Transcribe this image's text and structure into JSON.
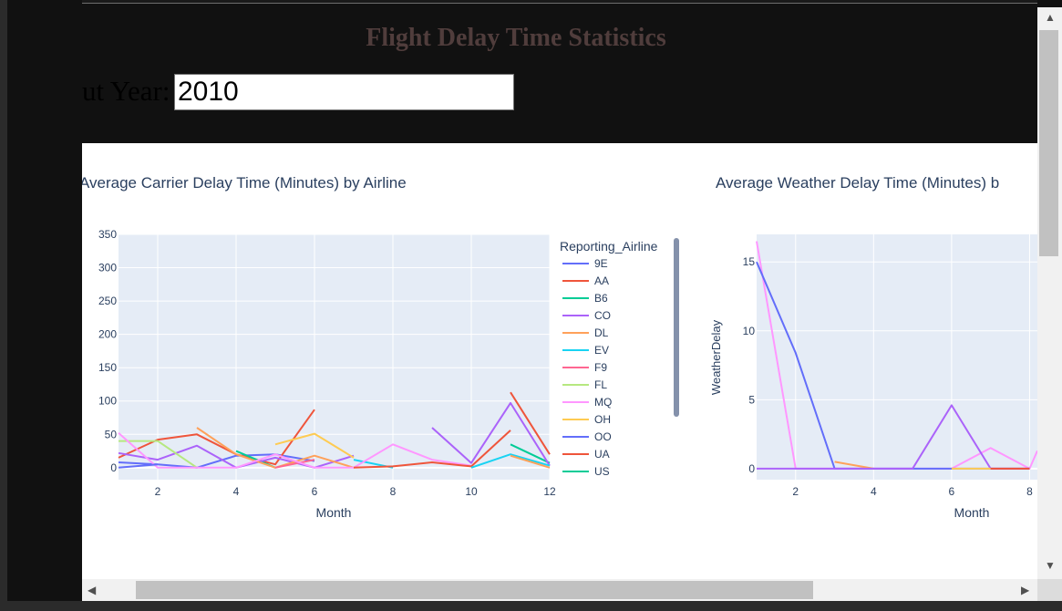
{
  "header": {
    "title": "Flight Delay Time Statistics",
    "year_label": "ut Year:",
    "year_value": "2010"
  },
  "colors": {
    "title": "#503d3c",
    "plot_bg": "#e5ecf6",
    "text": "#2a3f5f"
  },
  "legend": {
    "title": "Reporting_Airline",
    "items": [
      "9E",
      "AA",
      "B6",
      "CO",
      "DL",
      "EV",
      "F9",
      "FL",
      "MQ",
      "OH",
      "OO",
      "UA",
      "US"
    ]
  },
  "chart_data": [
    {
      "type": "line",
      "title": "Average Carrier Delay Time (Minutes) by Airline",
      "xlabel": "Month",
      "ylabel": "",
      "xlim": [
        1,
        12
      ],
      "ylim": [
        -18,
        350
      ],
      "x_ticks": [
        2,
        4,
        6,
        8,
        10,
        12
      ],
      "y_ticks": [
        0,
        50,
        100,
        150,
        200,
        250,
        300,
        350
      ],
      "series": [
        {
          "name": "9E",
          "color": "#636efa",
          "points": [
            [
              1,
              8
            ],
            [
              2,
              5
            ],
            [
              3,
              0
            ],
            [
              4,
              18
            ],
            [
              5,
              20
            ],
            [
              6,
              10
            ]
          ]
        },
        {
          "name": "AA",
          "color": "#ef553b",
          "points": [
            [
              1,
              15
            ],
            [
              2,
              42
            ],
            [
              3,
              50
            ],
            [
              4,
              20
            ],
            [
              5,
              5
            ],
            [
              6,
              87
            ]
          ]
        },
        {
          "name": "B6",
          "color": "#00cc96",
          "points": [
            [
              4,
              25
            ],
            [
              5,
              0
            ]
          ]
        },
        {
          "name": "CO",
          "color": "#ab63fa",
          "points": [
            [
              1,
              22
            ],
            [
              2,
              12
            ],
            [
              3,
              33
            ],
            [
              4,
              0
            ],
            [
              5,
              15
            ],
            [
              6,
              0
            ],
            [
              7,
              18
            ]
          ]
        },
        {
          "name": "DL",
          "color": "#ffa15a",
          "points": [
            [
              3,
              60
            ],
            [
              4,
              20
            ],
            [
              5,
              0
            ],
            [
              6,
              18
            ],
            [
              7,
              0
            ]
          ]
        },
        {
          "name": "EV",
          "color": "#19d3f3",
          "points": [
            [
              7,
              12
            ],
            [
              8,
              0
            ]
          ]
        },
        {
          "name": "F9",
          "color": "#ff6692",
          "points": [
            [
              5,
              0
            ],
            [
              6,
              12
            ]
          ]
        },
        {
          "name": "FL",
          "color": "#b6e880",
          "points": [
            [
              1,
              40
            ],
            [
              2,
              40
            ],
            [
              3,
              0
            ]
          ]
        },
        {
          "name": "MQ",
          "color": "#ff97ff",
          "points": [
            [
              1,
              52
            ],
            [
              2,
              0
            ],
            [
              3,
              0
            ],
            [
              4,
              0
            ],
            [
              5,
              20
            ],
            [
              6,
              0
            ],
            [
              7,
              0
            ],
            [
              8,
              35
            ],
            [
              9,
              12
            ],
            [
              10,
              3
            ]
          ]
        },
        {
          "name": "OH",
          "color": "#fecb52",
          "points": [
            [
              5,
              35
            ],
            [
              6,
              51
            ],
            [
              7,
              15
            ]
          ]
        },
        {
          "name": "OO",
          "color": "#636efa",
          "points": [
            [
              1,
              0
            ],
            [
              2,
              5
            ]
          ]
        },
        {
          "name": "UA",
          "color": "#ef553b",
          "points": [
            [
              7,
              0
            ],
            [
              8,
              2
            ],
            [
              9,
              8
            ],
            [
              10,
              2
            ],
            [
              11,
              56
            ]
          ]
        },
        {
          "name": "US",
          "color": "#00cc96",
          "points": [
            [
              11,
              35
            ],
            [
              12,
              7
            ]
          ]
        },
        {
          "name": "CO",
          "color": "#ab63fa",
          "points": [
            [
              9,
              60
            ],
            [
              10,
              7
            ],
            [
              11,
              97
            ],
            [
              12,
              3
            ]
          ]
        },
        {
          "name": "UA",
          "color": "#ef553b",
          "points": [
            [
              11,
              113
            ],
            [
              12,
              20
            ]
          ]
        },
        {
          "name": "EV",
          "color": "#19d3f3",
          "points": [
            [
              10,
              0
            ],
            [
              11,
              20
            ],
            [
              12,
              3
            ]
          ]
        },
        {
          "name": "DL",
          "color": "#ffa15a",
          "points": [
            [
              11,
              18
            ],
            [
              12,
              0
            ]
          ]
        }
      ]
    },
    {
      "type": "line",
      "title": "Average Weather Delay Time (Minutes) b",
      "xlabel": "Month",
      "ylabel": "WeatherDelay",
      "xlim": [
        1,
        8.2
      ],
      "ylim": [
        -0.8,
        17
      ],
      "x_ticks": [
        2,
        4,
        6,
        8
      ],
      "y_ticks": [
        0,
        5,
        10,
        15
      ],
      "series": [
        {
          "name": "MQ",
          "color": "#ff97ff",
          "points": [
            [
              1,
              16.5
            ],
            [
              2,
              0
            ],
            [
              3,
              0
            ],
            [
              4,
              0
            ],
            [
              5,
              0
            ],
            [
              6,
              0
            ],
            [
              7,
              1.5
            ],
            [
              8,
              0
            ],
            [
              8.2,
              1.3
            ]
          ]
        },
        {
          "name": "9E",
          "color": "#636efa",
          "points": [
            [
              1,
              15
            ],
            [
              2,
              8.4
            ],
            [
              3,
              0
            ],
            [
              4,
              0
            ],
            [
              5,
              0
            ],
            [
              6,
              0
            ],
            [
              7,
              0
            ],
            [
              8,
              0
            ]
          ]
        },
        {
          "name": "DL",
          "color": "#ffa15a",
          "points": [
            [
              3,
              0.5
            ],
            [
              4,
              0
            ]
          ]
        },
        {
          "name": "CO",
          "color": "#ab63fa",
          "points": [
            [
              1,
              0
            ],
            [
              2,
              0
            ],
            [
              3,
              0
            ],
            [
              4,
              0
            ],
            [
              5,
              0
            ],
            [
              6,
              4.6
            ],
            [
              7,
              0
            ],
            [
              8,
              0
            ]
          ]
        },
        {
          "name": "OH",
          "color": "#fecb52",
          "points": [
            [
              6,
              0
            ],
            [
              7,
              0
            ]
          ]
        },
        {
          "name": "UA",
          "color": "#ef553b",
          "points": [
            [
              7,
              0
            ],
            [
              8,
              0
            ]
          ]
        }
      ]
    }
  ]
}
